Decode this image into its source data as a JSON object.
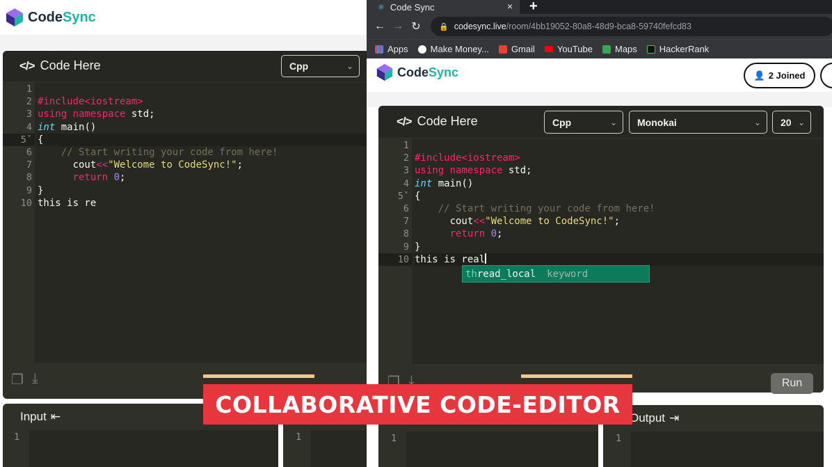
{
  "left": {
    "brand": {
      "name_a": "Code",
      "name_b": "Sync"
    },
    "editor": {
      "title": "Code Here",
      "language": "Cpp",
      "line_numbers": [
        "1",
        "2",
        "3",
        "4",
        "5",
        "6",
        "7",
        "8",
        "9",
        "10"
      ],
      "last_line": "this is re"
    },
    "input": {
      "title": "Input",
      "line": "1"
    },
    "output": {
      "line": "1"
    }
  },
  "right": {
    "tab": {
      "title": "Code Sync",
      "close": "×",
      "new": "+"
    },
    "url": {
      "host": "codesync.live",
      "path": "/room/4bb19052-80a8-48d9-bca8-59740fefcd83"
    },
    "bookmarks": [
      "Apps",
      "Make Money...",
      "Gmail",
      "YouTube",
      "Maps",
      "HackerRank"
    ],
    "brand": {
      "name_a": "Code",
      "name_b": "Sync"
    },
    "joined": "2 Joined",
    "editor": {
      "title": "Code Here",
      "language": "Cpp",
      "theme": "Monokai",
      "font_size": "20",
      "line_numbers": [
        "1",
        "2",
        "3",
        "4",
        "5",
        "6",
        "7",
        "8",
        "9",
        "10"
      ],
      "last_line": "this is real"
    },
    "autocomplete": {
      "match": "th",
      "rest": "read_local",
      "kind": "keyword"
    },
    "run": "Run",
    "output": {
      "title": "Output",
      "line": "1"
    },
    "input": {
      "line": "1"
    }
  },
  "code": {
    "include": "#include<iostream>",
    "using": "using",
    "namespace": "namespace",
    "std": " std;",
    "int": "int",
    "main": " main()",
    "open": "{",
    "comment": "// Start writing your code from here!",
    "cout": "cout",
    "op": "<<",
    "str": "\"Welcome to CodeSync!\"",
    "semi": ";",
    "return": "return",
    "zero": "0",
    "close": "}"
  },
  "caption": "COLLABORATIVE CODE-EDITOR"
}
